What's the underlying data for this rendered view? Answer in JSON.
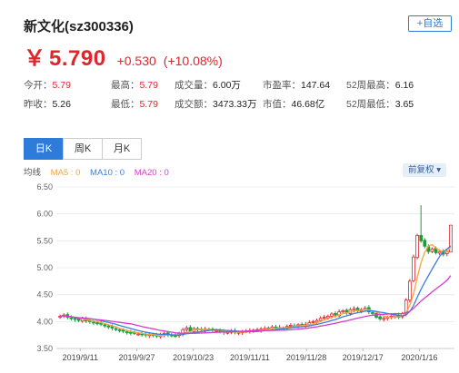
{
  "header": {
    "title": "新文化(sz300336)",
    "add_fav_label": "+自选"
  },
  "quote": {
    "currency": "￥",
    "price": "5.790",
    "change": "+0.530",
    "change_pct": "(+10.08%)"
  },
  "stats": [
    [
      {
        "label": "今开：",
        "value": "5.79",
        "red": true
      },
      {
        "label": "最高：",
        "value": "5.79",
        "red": true
      },
      {
        "label": "成交量：",
        "value": "6.00万",
        "red": false
      },
      {
        "label": "市盈率：",
        "value": "147.64",
        "red": false
      },
      {
        "label": "52周最高：",
        "value": "6.16",
        "red": false
      }
    ],
    [
      {
        "label": "昨收：",
        "value": "5.26",
        "red": false
      },
      {
        "label": "最低：",
        "value": "5.79",
        "red": true
      },
      {
        "label": "成交额：",
        "value": "3473.33万",
        "red": false
      },
      {
        "label": "市值：",
        "value": "46.68亿",
        "red": false
      },
      {
        "label": "52周最低：",
        "value": "3.65",
        "red": false
      }
    ]
  ],
  "tabs": [
    "日K",
    "周K",
    "月K"
  ],
  "legend": {
    "label": "均线",
    "ma5": "MA5 : 0",
    "ma10": "MA10 : 0",
    "ma20": "MA20 : 0"
  },
  "adjust_label": "前复权",
  "colors": {
    "up": "#e0262c",
    "down": "#1a9e3a",
    "ma5": "#f4a640",
    "ma10": "#3a7de0",
    "ma20": "#d63cc8",
    "accent": "#2f7bd9"
  },
  "chart_data": {
    "type": "candlestick",
    "ylim": [
      3.5,
      6.5
    ],
    "yticks": [
      3.5,
      4.0,
      4.5,
      5.0,
      5.5,
      6.0,
      6.5
    ],
    "xticks": [
      "2019/9/11",
      "2019/9/27",
      "2019/10/23",
      "2019/11/11",
      "2019/11/28",
      "2019/12/17",
      "2020/1/16"
    ],
    "last_price": 5.79,
    "close": [
      4.1,
      4.12,
      4.08,
      4.06,
      4.04,
      4.02,
      4.05,
      4.01,
      4.0,
      3.98,
      3.96,
      3.95,
      3.92,
      3.9,
      3.88,
      3.85,
      3.83,
      3.82,
      3.8,
      3.79,
      3.78,
      3.77,
      3.76,
      3.75,
      3.76,
      3.74,
      3.73,
      3.75,
      3.78,
      3.76,
      3.74,
      3.73,
      3.78,
      3.85,
      3.88,
      3.82,
      3.87,
      3.85,
      3.84,
      3.86,
      3.85,
      3.84,
      3.83,
      3.82,
      3.8,
      3.8,
      3.82,
      3.8,
      3.8,
      3.81,
      3.82,
      3.83,
      3.84,
      3.85,
      3.86,
      3.87,
      3.88,
      3.9,
      3.87,
      3.89,
      3.88,
      3.91,
      3.93,
      3.92,
      3.94,
      3.93,
      3.95,
      3.98,
      4.0,
      4.02,
      4.06,
      4.08,
      4.1,
      4.14,
      4.12,
      4.18,
      4.2,
      4.16,
      4.22,
      4.24,
      4.2,
      4.22,
      4.25,
      4.18,
      4.15,
      4.08,
      4.05,
      4.06,
      4.08,
      4.1,
      4.12,
      4.08,
      4.15,
      4.4,
      4.75,
      5.2,
      5.6,
      5.5,
      5.4,
      5.3,
      5.35,
      5.28,
      5.3,
      5.25,
      5.3,
      5.79
    ]
  }
}
